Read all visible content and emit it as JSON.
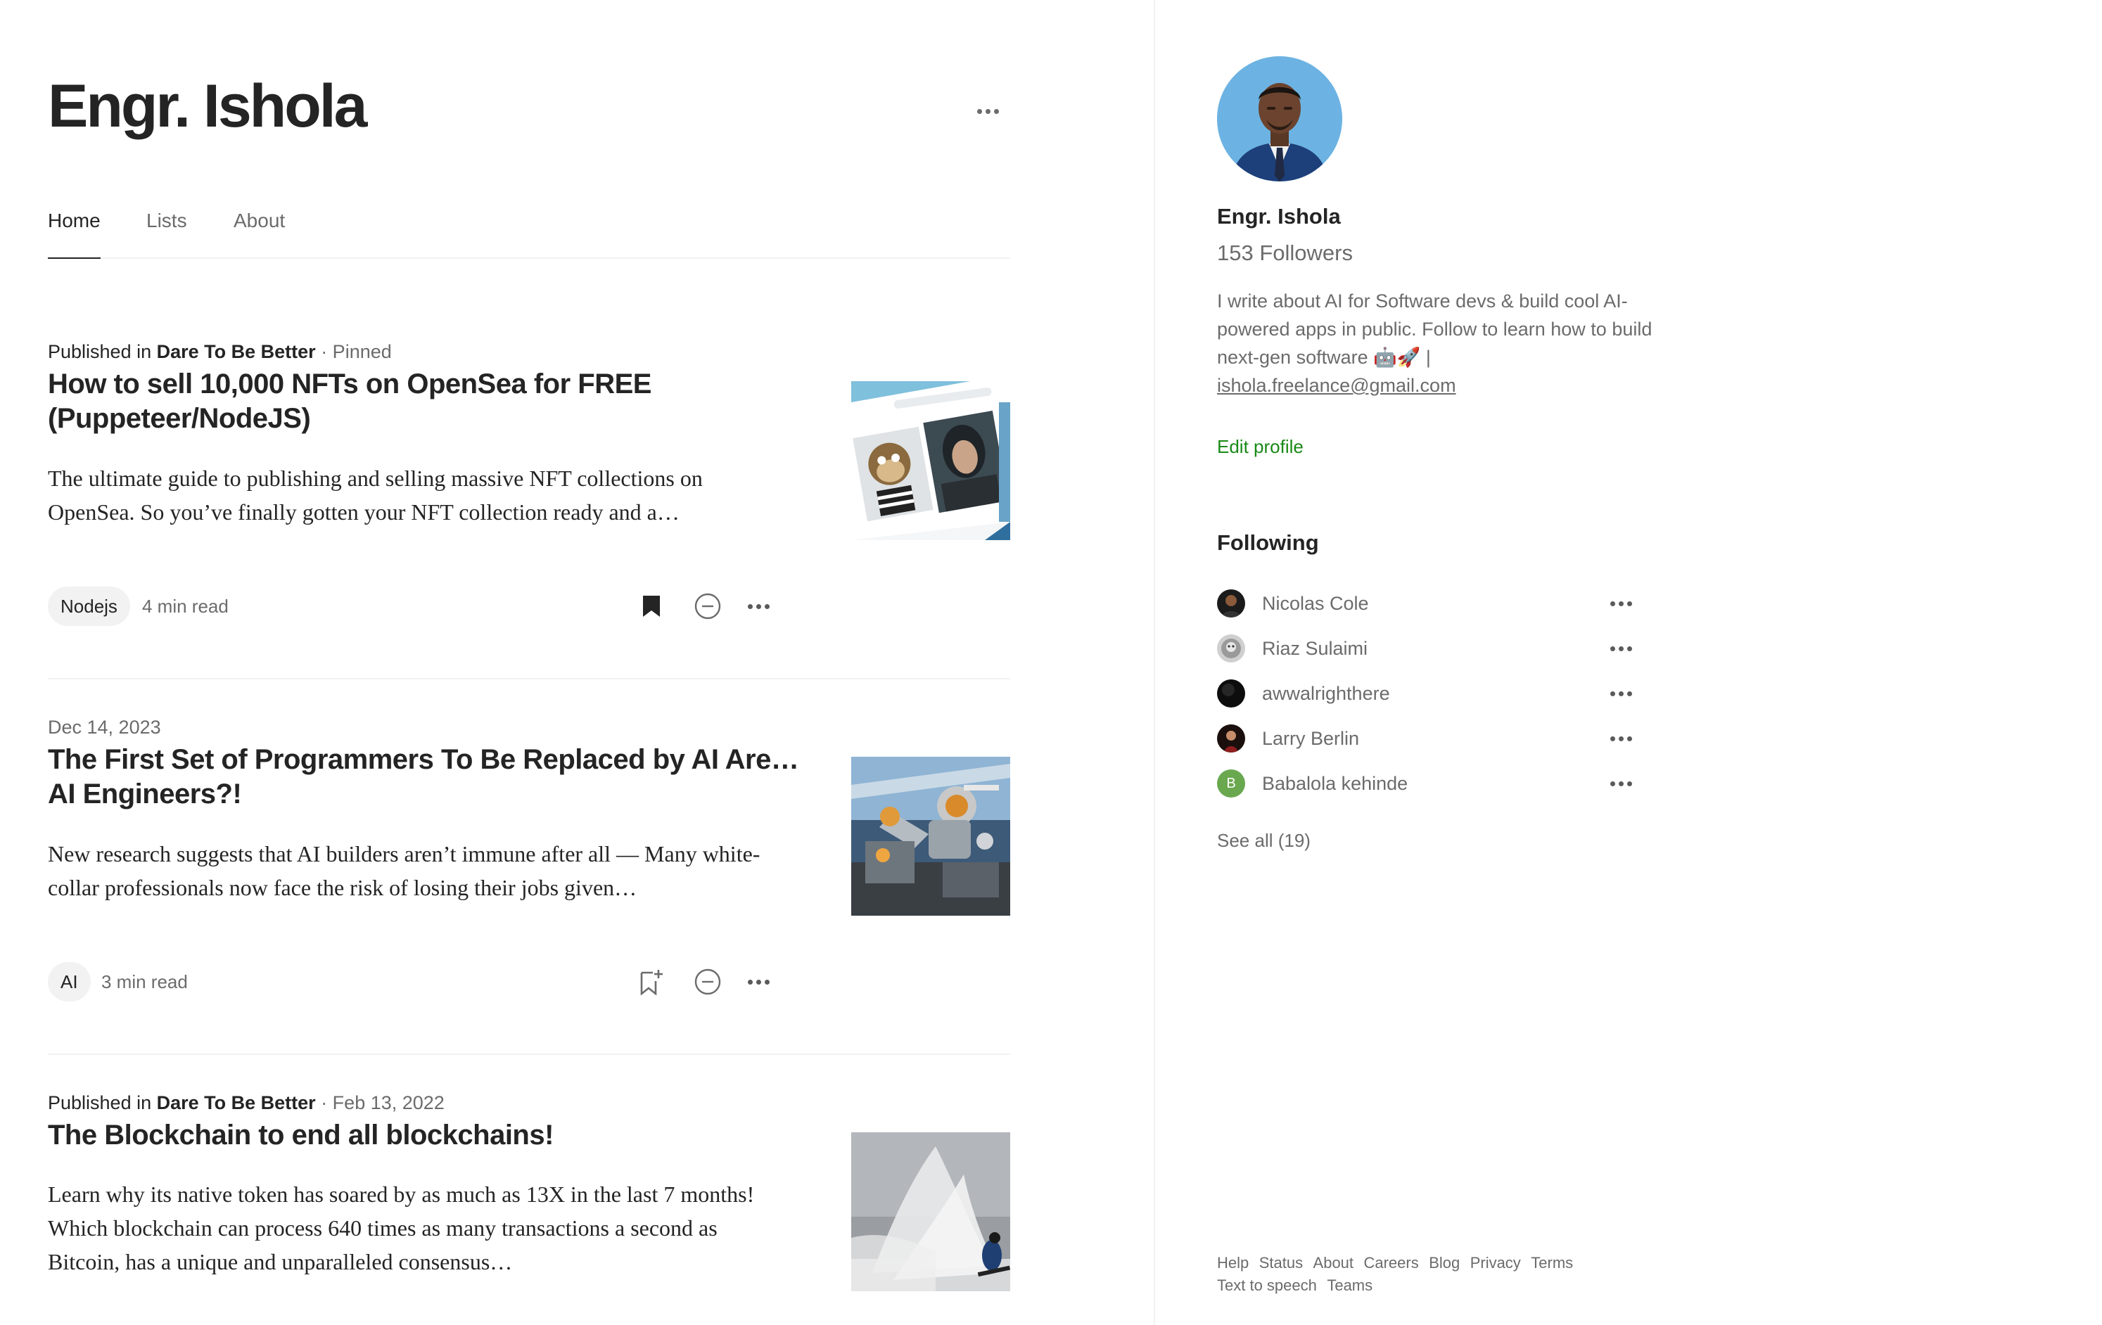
{
  "profile": {
    "name": "Engr. Ishola"
  },
  "header": {
    "more_icon": "more-horizontal-icon"
  },
  "tabs": [
    {
      "label": "Home",
      "active": true
    },
    {
      "label": "Lists",
      "active": false
    },
    {
      "label": "About",
      "active": false
    }
  ],
  "articles": [
    {
      "meta": {
        "prefix": "Published in",
        "publication": "Dare To Be Better",
        "suffix": " · Pinned"
      },
      "title": "How to sell 10,000 NFTs on OpenSea for FREE (Puppeteer/NodeJS)",
      "subtitle": "The ultimate guide to publishing and selling massive NFT collections on OpenSea. So you’ve finally gotten your NFT collection ready and a…",
      "tag": "Nodejs",
      "read_time": "4 min read",
      "saved": true
    },
    {
      "meta": {
        "date": "Dec 14, 2023"
      },
      "title": "The First Set of Programmers To Be Replaced by AI Are…AI Engineers?!",
      "subtitle": "New research suggests that AI builders aren’t immune after all — Many white-collar professionals now face the risk of losing their jobs given…",
      "tag": "AI",
      "read_time": "3 min read",
      "saved": false
    },
    {
      "meta": {
        "prefix": "Published in",
        "publication": "Dare To Be Better",
        "suffix": " · Feb 13, 2022"
      },
      "title": "The Blockchain to end all blockchains!",
      "subtitle": "Learn why its native token has soared by as much as 13X in the last 7 months! Which blockchain can process 640 times as many transactions a second as Bitcoin, has a unique and unparalleled consensus…"
    }
  ],
  "sidebar": {
    "name": "Engr. Ishola",
    "followers": "153 Followers",
    "bio_text": "I write about AI for Software devs & build cool AI-powered apps in public. Follow to learn how to build next-gen software 🤖🚀 |",
    "bio_email": "ishola.freelance@gmail.com",
    "edit_profile": "Edit profile",
    "following_heading": "Following",
    "following": [
      {
        "name": "Nicolas Cole"
      },
      {
        "name": "Riaz Sulaimi"
      },
      {
        "name": "awwalrighthere"
      },
      {
        "name": "Larry Berlin"
      },
      {
        "name": "Babalola kehinde",
        "initial": "B"
      }
    ],
    "see_all": "See all (19)",
    "footer_links": [
      "Help",
      "Status",
      "About",
      "Careers",
      "Blog",
      "Privacy",
      "Terms",
      "Text to speech",
      "Teams"
    ]
  },
  "colors": {
    "accent_green": "#1a8917",
    "text_primary": "#242424",
    "text_secondary": "#6b6b6b",
    "divider": "#f2f2f2"
  }
}
